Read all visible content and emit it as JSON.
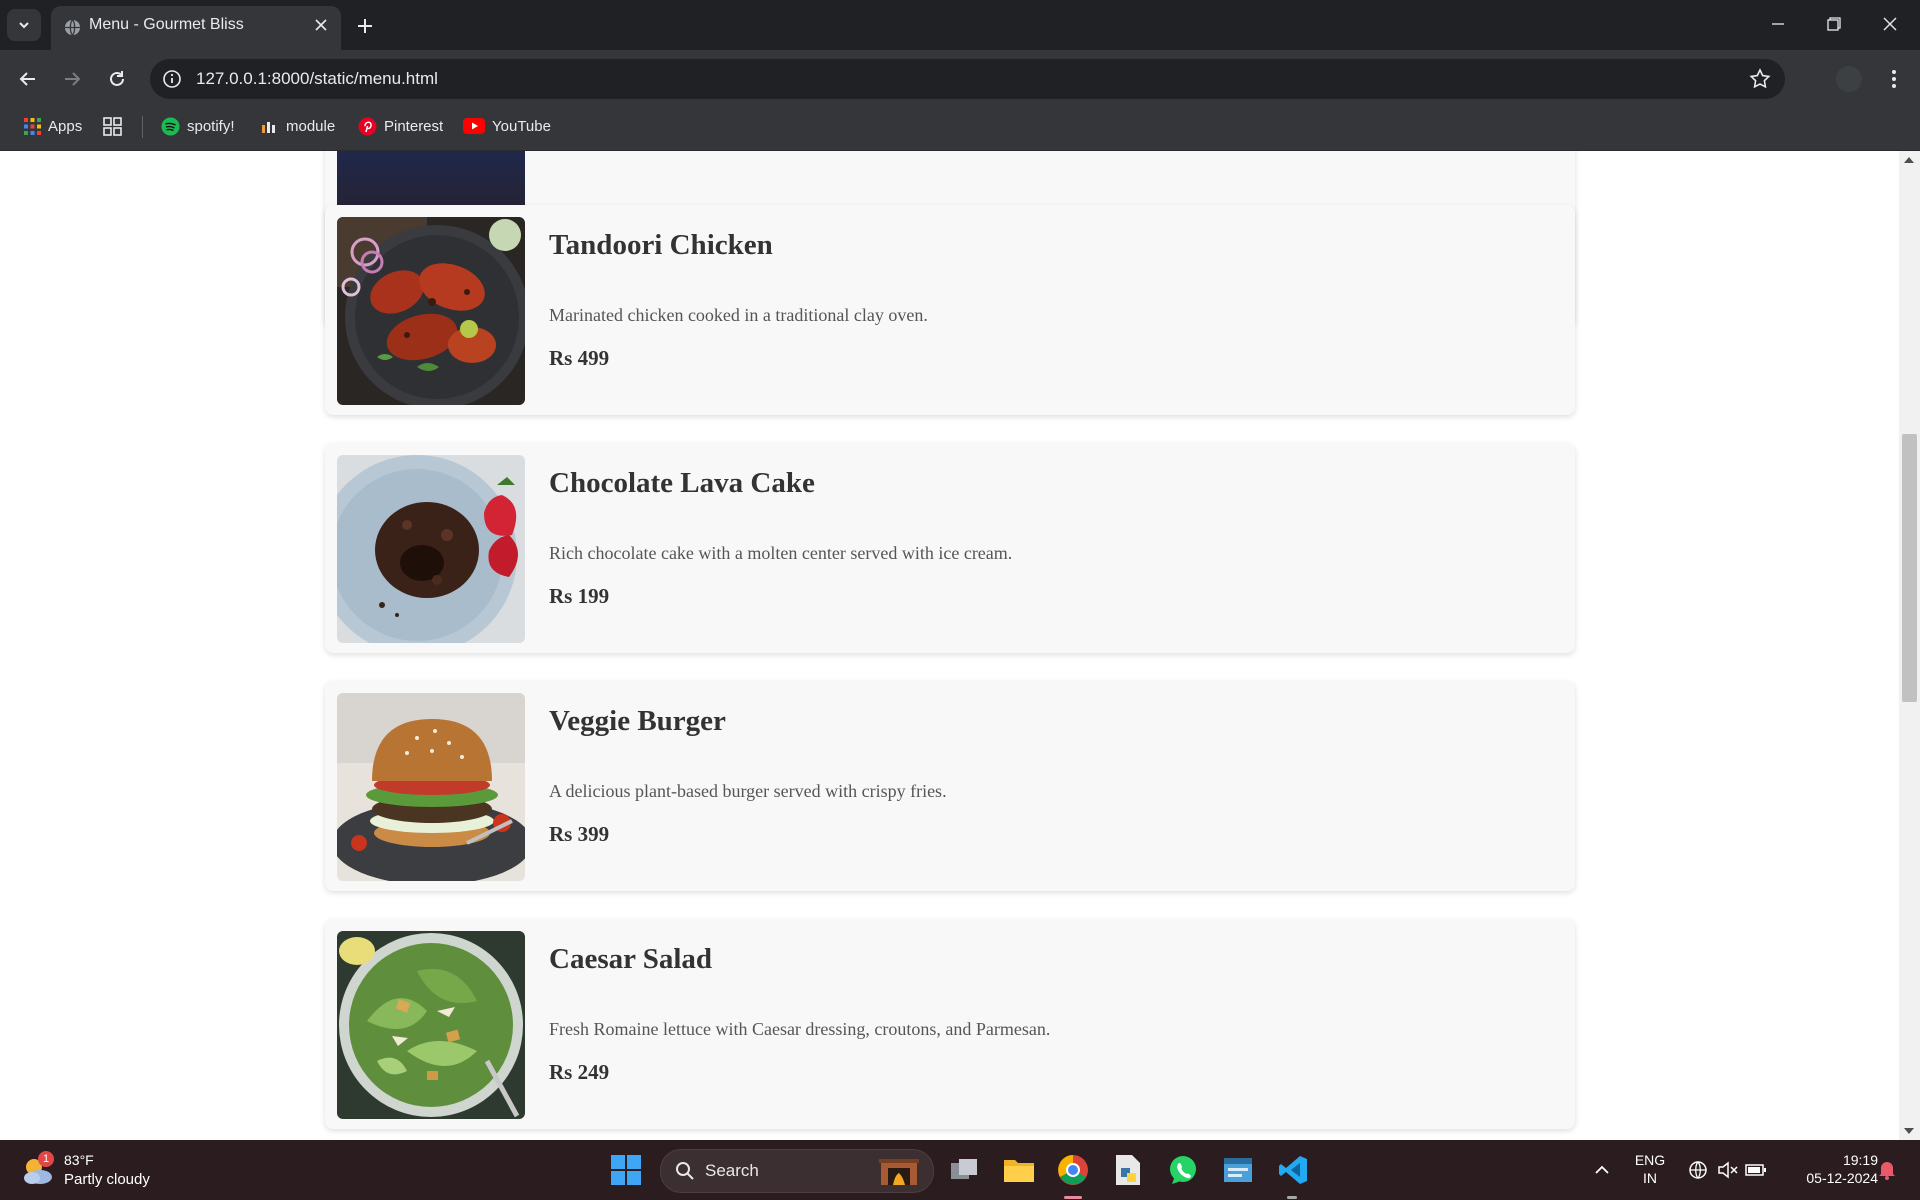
{
  "browser": {
    "tab_title": "Menu - Gourmet Bliss",
    "url": "127.0.0.1:8000/static/menu.html",
    "bookmarks": [
      {
        "label": "Apps",
        "icon": "apps-grid-icon"
      },
      {
        "label": "",
        "icon": "tab-groups-icon"
      },
      {
        "label": "spotify!",
        "icon": "spotify-icon"
      },
      {
        "label": "module",
        "icon": "module-icon"
      },
      {
        "label": "Pinterest",
        "icon": "pinterest-icon"
      },
      {
        "label": "YouTube",
        "icon": "youtube-icon"
      }
    ]
  },
  "menu": {
    "items": [
      {
        "name": "Tandoori Chicken",
        "description": "Marinated chicken cooked in a traditional clay oven.",
        "price": "Rs 499"
      },
      {
        "name": "Chocolate Lava Cake",
        "description": "Rich chocolate cake with a molten center served with ice cream.",
        "price": "Rs 199"
      },
      {
        "name": "Veggie Burger",
        "description": "A delicious plant-based burger served with crispy fries.",
        "price": "Rs 399"
      },
      {
        "name": "Caesar Salad",
        "description": "Fresh Romaine lettuce with Caesar dressing, croutons, and Parmesan.",
        "price": "Rs 249"
      }
    ]
  },
  "taskbar": {
    "weather_temp": "83°F",
    "weather_condition": "Partly cloudy",
    "weather_badge": "1",
    "search_label": "Search",
    "lang_line1": "ENG",
    "lang_line2": "IN",
    "time": "19:19",
    "date": "05-12-2024"
  },
  "colors": {
    "chrome_dark": "#202124",
    "chrome_toolbar": "#35363a",
    "card_bg": "#f8f8f8",
    "title_text": "#333333",
    "taskbar_bg": "#2b1d1f"
  }
}
